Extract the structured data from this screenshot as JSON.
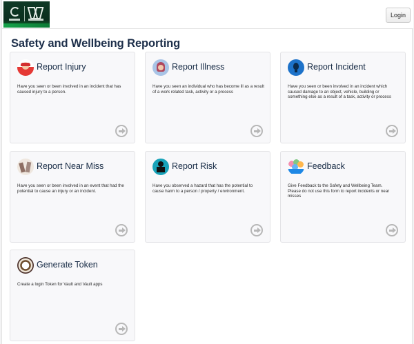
{
  "header": {
    "login_label": "Login"
  },
  "page": {
    "title": "Safety and Wellbeing Reporting"
  },
  "cards": [
    {
      "title": "Report Injury",
      "description": "Have you seen or been involved in an incident that has caused injury to a person.",
      "icon": "injury-icon"
    },
    {
      "title": "Report Illness",
      "description": "Have you seen an individual who has become ill as a result of a work related task, activity or a process",
      "icon": "illness-icon"
    },
    {
      "title": "Report Incident",
      "description": "Have you seen or been involved in an incident which caused damage to an object, vehicle, building or something else as a result of a task, activity or process",
      "icon": "lightbulb-icon"
    },
    {
      "title": "Report Near Miss",
      "description": "Have you seen or been involved in an event that had the potential to cause an injury or an incident.",
      "icon": "near-miss-icon"
    },
    {
      "title": "Report Risk",
      "description": "Have you observed a hazard that has the potential to cause harm to a person / property / environment.",
      "icon": "risk-icon"
    },
    {
      "title": "Feedback",
      "description": "Give Feedback to the Safety and Wellbeing Team.\nPlease do not use this form to report incidents or near misses",
      "icon": "feedback-icon"
    },
    {
      "title": "Generate Token",
      "description": "Create a login Token for Vault and Vault apps",
      "icon": "token-icon"
    }
  ]
}
